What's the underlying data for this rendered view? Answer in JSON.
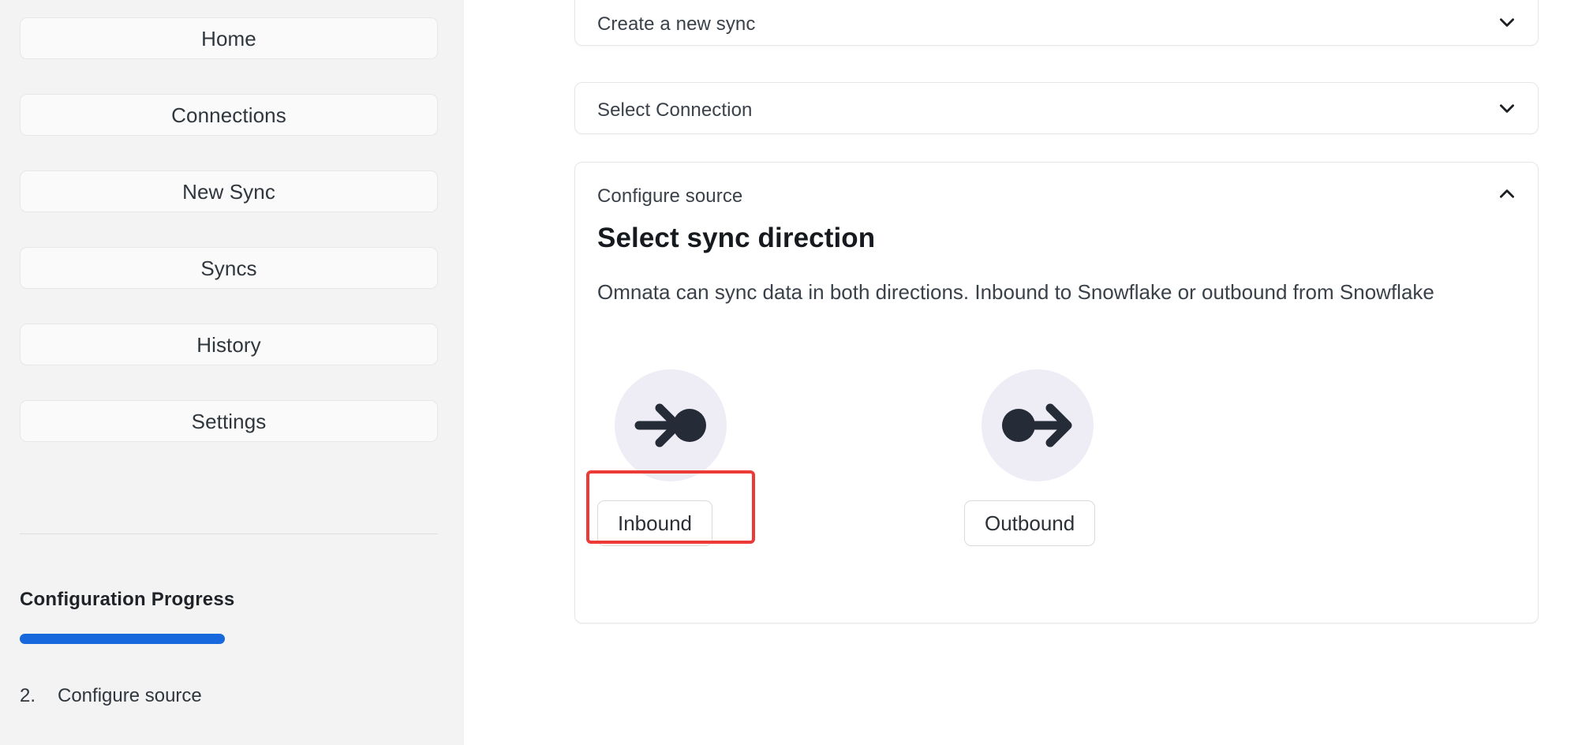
{
  "sidebar": {
    "nav_items": [
      {
        "label": "Home",
        "name": "sidebar-item-home"
      },
      {
        "label": "Connections",
        "name": "sidebar-item-connections"
      },
      {
        "label": "New Sync",
        "name": "sidebar-item-new-sync"
      },
      {
        "label": "Syncs",
        "name": "sidebar-item-syncs"
      },
      {
        "label": "History",
        "name": "sidebar-item-history"
      },
      {
        "label": "Settings",
        "name": "sidebar-item-settings"
      }
    ],
    "progress": {
      "title": "Configuration Progress",
      "percent": 49,
      "fill_color": "#1668dc",
      "current_step_number": "2.",
      "current_step_label": "Configure source"
    }
  },
  "main": {
    "cards": [
      {
        "label": "Create a new sync",
        "chevron": "chevron-down-icon",
        "expanded": false
      },
      {
        "label": "Select Connection",
        "chevron": "chevron-down-icon",
        "expanded": false
      },
      {
        "label": "Configure source",
        "chevron": "chevron-up-icon",
        "expanded": true
      }
    ],
    "configure_source": {
      "eyebrow": "Configure source",
      "title": "Select sync direction",
      "description": "Omnata can sync data in both directions. Inbound to Snowflake or outbound from Snowflake",
      "options": [
        {
          "label": "Inbound",
          "icon": "arrow-into-circle-icon",
          "highlighted": true
        },
        {
          "label": "Outbound",
          "icon": "circle-out-arrow-icon",
          "highlighted": false
        }
      ]
    }
  },
  "colors": {
    "sidebar_bg": "#f3f3f4",
    "progress_blue": "#1668dc",
    "icon_circle_bg": "#eeedf6",
    "icon_dark": "#262b38",
    "highlight_red": "#ec3b36"
  }
}
